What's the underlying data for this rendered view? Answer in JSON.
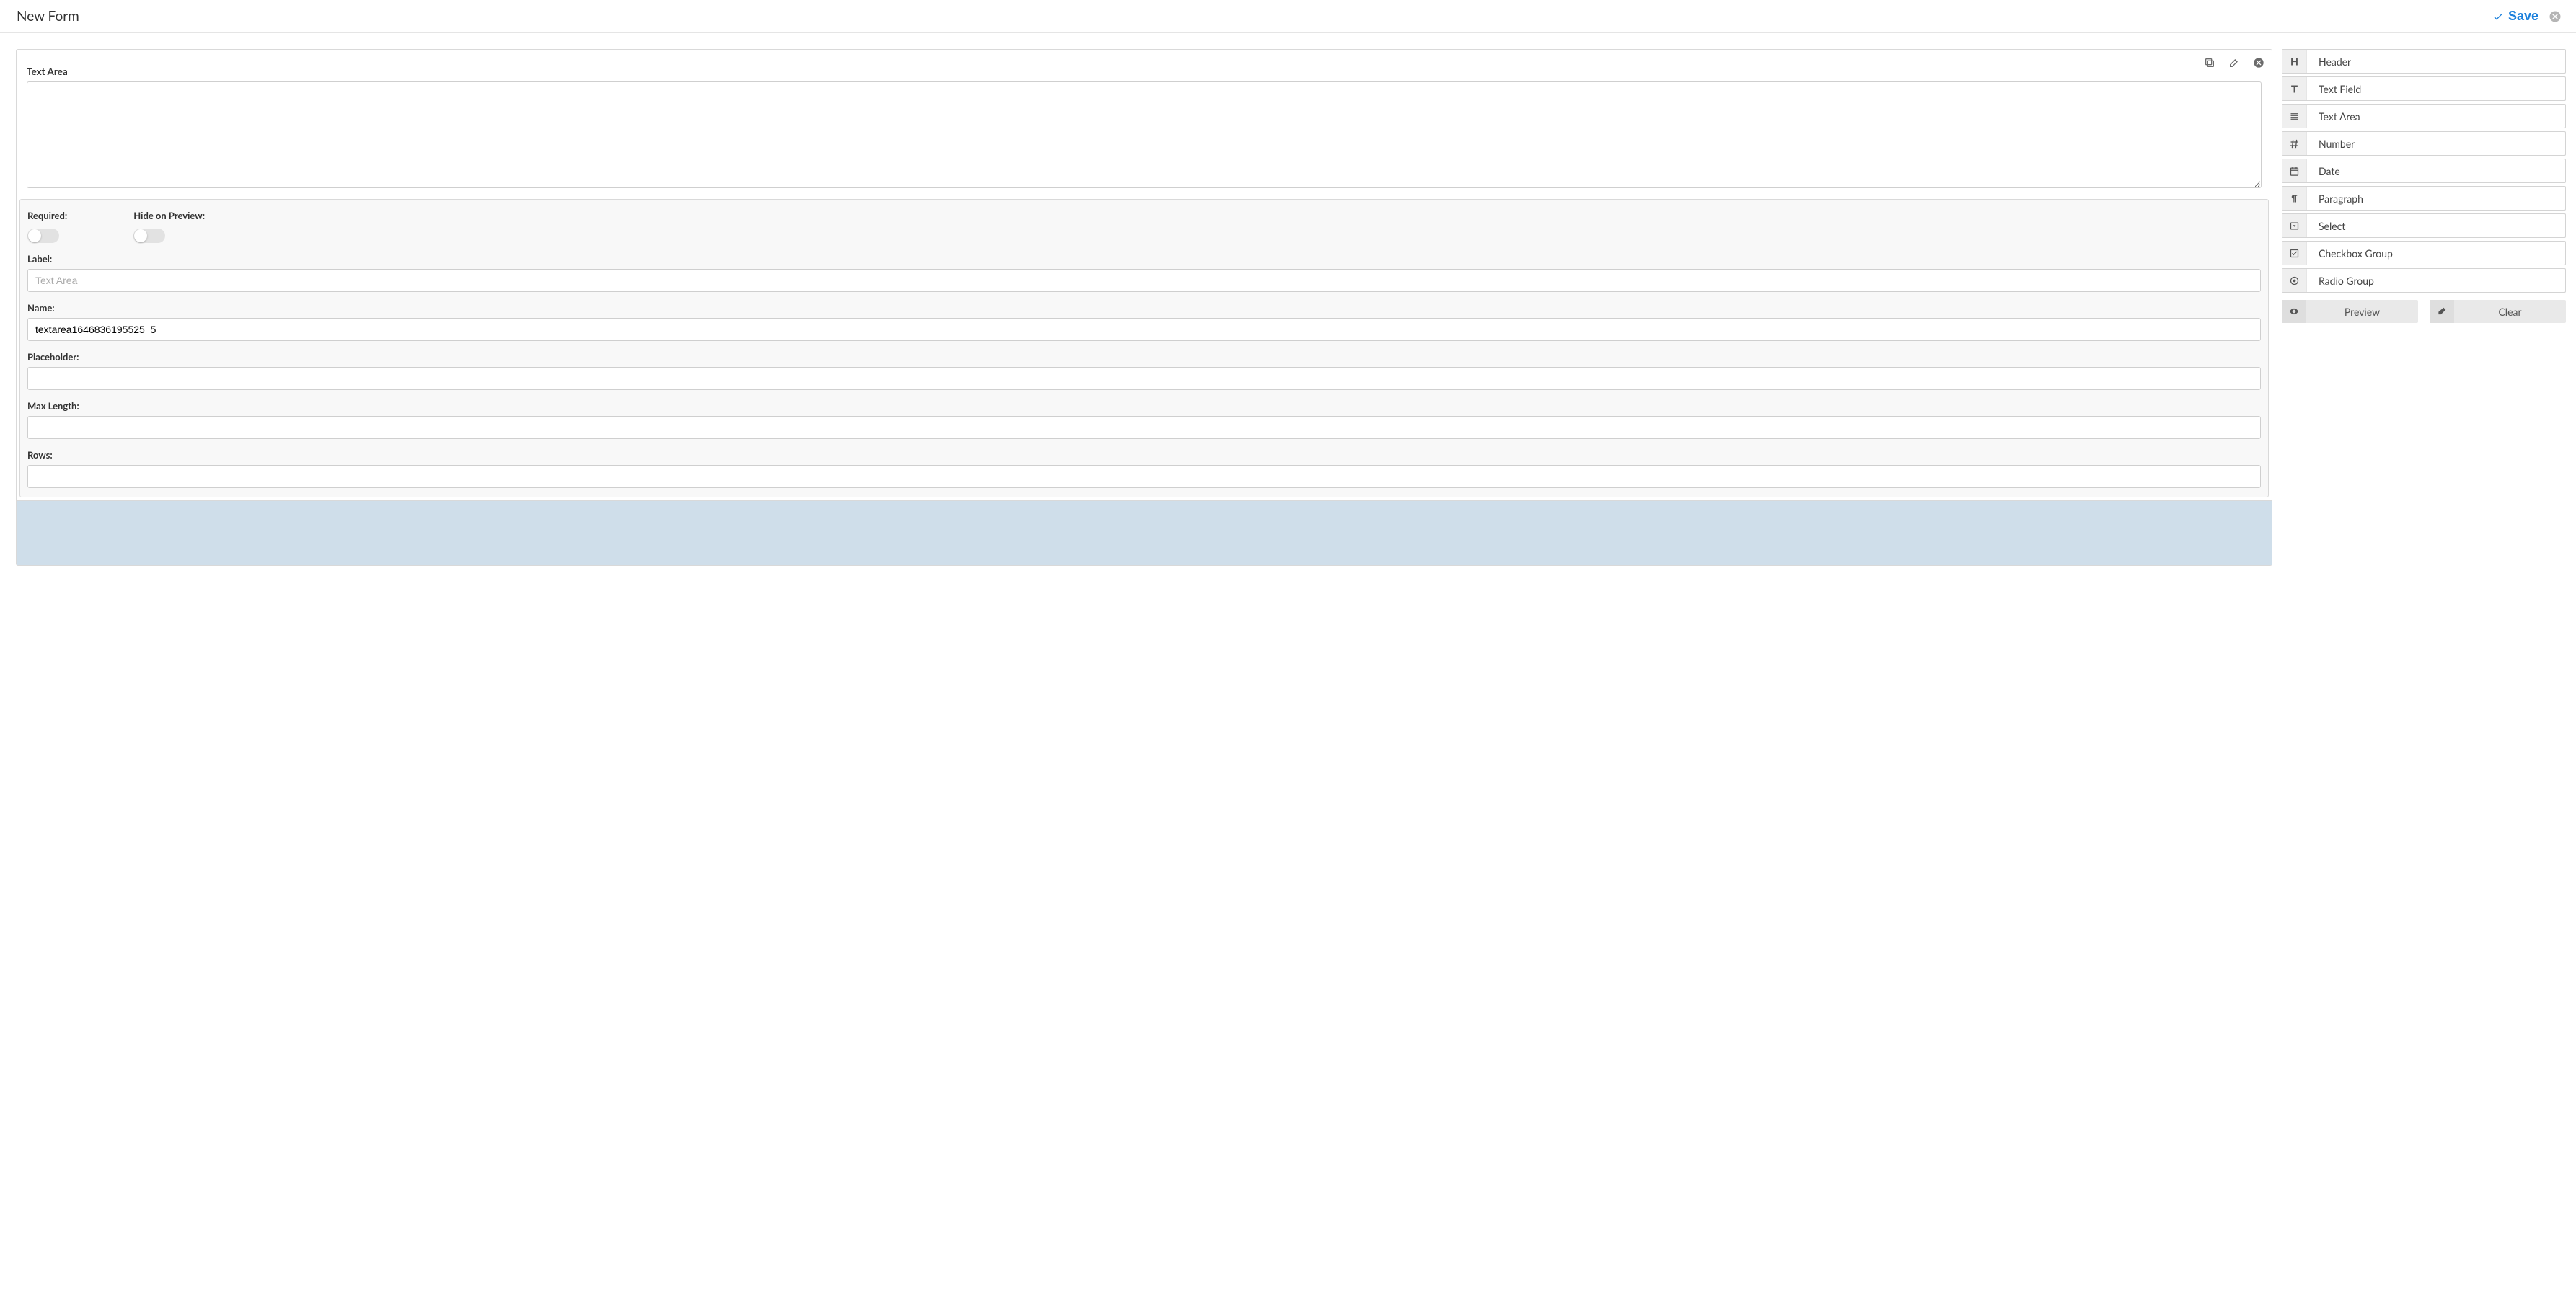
{
  "header": {
    "title": "New Form",
    "save_label": "Save"
  },
  "field": {
    "typeLabel": "Text Area",
    "textareaValue": ""
  },
  "settings": {
    "required": {
      "label": "Required:",
      "checked": false
    },
    "hideOnPreview": {
      "label": "Hide on Preview:",
      "checked": false
    },
    "label": {
      "label": "Label:",
      "value": "",
      "placeholder": "Text Area"
    },
    "name": {
      "label": "Name:",
      "value": "textarea1646836195525_5"
    },
    "placeholder": {
      "label": "Placeholder:",
      "value": ""
    },
    "maxLength": {
      "label": "Max Length:",
      "value": ""
    },
    "rows": {
      "label": "Rows:",
      "value": ""
    }
  },
  "palette": {
    "items": [
      {
        "id": "header",
        "label": "Header",
        "icon": "heading-icon"
      },
      {
        "id": "textfield",
        "label": "Text Field",
        "icon": "text-cursor-icon"
      },
      {
        "id": "textarea",
        "label": "Text Area",
        "icon": "lines-icon"
      },
      {
        "id": "number",
        "label": "Number",
        "icon": "hash-icon"
      },
      {
        "id": "date",
        "label": "Date",
        "icon": "calendar-icon"
      },
      {
        "id": "paragraph",
        "label": "Paragraph",
        "icon": "pilcrow-icon"
      },
      {
        "id": "select",
        "label": "Select",
        "icon": "dropdown-icon"
      },
      {
        "id": "checkboxgroup",
        "label": "Checkbox Group",
        "icon": "checkbox-icon"
      },
      {
        "id": "radiogroup",
        "label": "Radio Group",
        "icon": "radio-icon"
      }
    ],
    "preview_label": "Preview",
    "clear_label": "Clear"
  }
}
